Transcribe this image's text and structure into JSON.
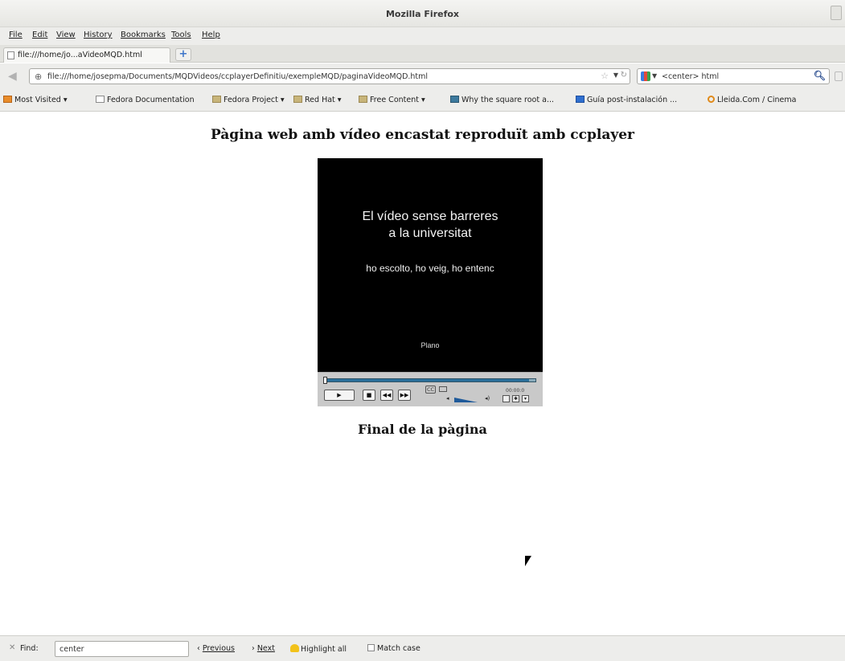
{
  "window": {
    "title": "Mozilla Firefox"
  },
  "menu": {
    "file": "File",
    "edit": "Edit",
    "view": "View",
    "history": "History",
    "bookmarks": "Bookmarks",
    "tools": "Tools",
    "help": "Help"
  },
  "tabs": [
    {
      "label": "file:///home/jo...aVideoMQD.html",
      "active": true
    }
  ],
  "new_tab_label": "+",
  "urlbar": {
    "value": "file:///home/josepma/Documents/MQDVideos/ccplayerDefinitiu/exempleMQD/paginaVideoMQD.html"
  },
  "searchbar": {
    "value": "<center> html"
  },
  "bookmarks_bar": [
    {
      "label": "Most Visited",
      "icon": "orange-folder-icon",
      "dropdown": true
    },
    {
      "label": "Fedora Documentation",
      "icon": "page-icon",
      "dropdown": false
    },
    {
      "label": "Fedora Project",
      "icon": "folder-icon",
      "dropdown": true
    },
    {
      "label": "Red Hat",
      "icon": "folder-icon",
      "dropdown": true
    },
    {
      "label": "Free Content",
      "icon": "folder-icon",
      "dropdown": true
    },
    {
      "label": "Why the square root a...",
      "icon": "book-icon",
      "dropdown": false
    },
    {
      "label": "Guía post-instalación ...",
      "icon": "blue-page-icon",
      "dropdown": false
    },
    {
      "label": "Lleida.Com / Cinema",
      "icon": "ring-icon",
      "dropdown": false
    }
  ],
  "page": {
    "title": "Pàgina web amb vídeo encastat reproduït amb ccplayer",
    "video_line1": "El vídeo sense barreres",
    "video_line2": "a la universitat",
    "video_line3": "ho escolto, ho veig, ho entenc",
    "video_line4": "Plano",
    "footer": "Final de la pàgina"
  },
  "player": {
    "cc_label": "CC",
    "time": "00:00:0",
    "progress": 0.97,
    "volume": 0.8
  },
  "findbar": {
    "label": "Find:",
    "value": "center",
    "previous": "Previous",
    "next": "Next",
    "highlight_all": "Highlight all",
    "match_case": "Match case"
  }
}
